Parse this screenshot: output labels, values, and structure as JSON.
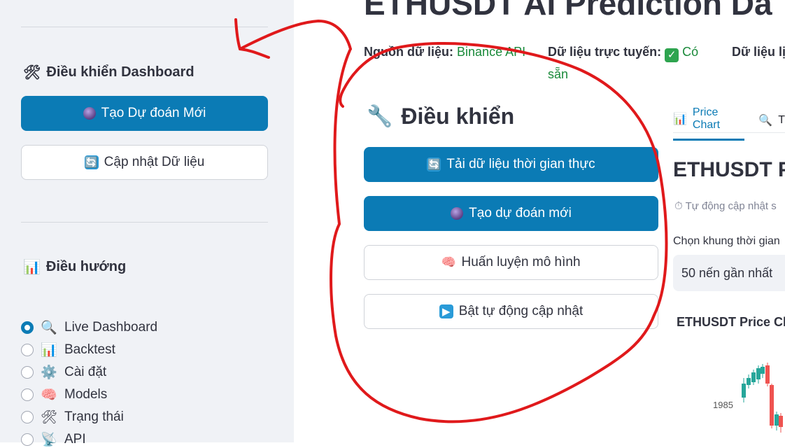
{
  "sidebar": {
    "control_heading": "Điều khiển Dashboard",
    "control_heading_icon": "hammer-wrench-icon",
    "new_prediction_label": "Tạo Dự đoán Mới",
    "update_data_label": "Cập nhật Dữ liệu",
    "nav_heading": "Điều hướng",
    "nav_items": [
      {
        "label": "Live Dashboard",
        "icon": "magnifier-icon",
        "selected": true
      },
      {
        "label": "Backtest",
        "icon": "bar-chart-icon",
        "selected": false
      },
      {
        "label": "Cài đặt",
        "icon": "gear-icon",
        "selected": false
      },
      {
        "label": "Models",
        "icon": "brain-icon",
        "selected": false
      },
      {
        "label": "Trạng thái",
        "icon": "hammer-wrench-icon",
        "selected": false
      },
      {
        "label": "API",
        "icon": "satellite-icon",
        "selected": false
      }
    ]
  },
  "header": {
    "title": "ETHUSDT AI Prediction Da",
    "source_label": "Nguồn dữ liệu:",
    "source_value": "Binance API",
    "online_label": "Dữ liệu trực tuyến:",
    "online_value_line1": "Có",
    "online_value_line2": "sẵn",
    "third_label": "Dữ liệu lị"
  },
  "controls": {
    "title": "Điều khiển",
    "load_realtime_label": "Tải dữ liệu thời gian thực",
    "new_prediction_label": "Tạo dự đoán mới",
    "train_model_label": "Huấn luyện mô hình",
    "auto_update_label": "Bật tự động cập nhật"
  },
  "right_panel": {
    "tab_price_chart": "Price Chart",
    "tab_second_partial": "T",
    "heading": "ETHUSDT P",
    "auto_update_text": "Tự động cập nhật s",
    "timeframe_label": "Chọn khung thời gian",
    "timeframe_value": "50 nến gần nhất",
    "chart_title": "ETHUSDT Price Ch",
    "y_tick": "1985"
  },
  "colors": {
    "primary": "#0b7bb5",
    "sidebar_bg": "#f0f2f6",
    "success": "#1a8a3a",
    "annotation": "#e0191b"
  }
}
